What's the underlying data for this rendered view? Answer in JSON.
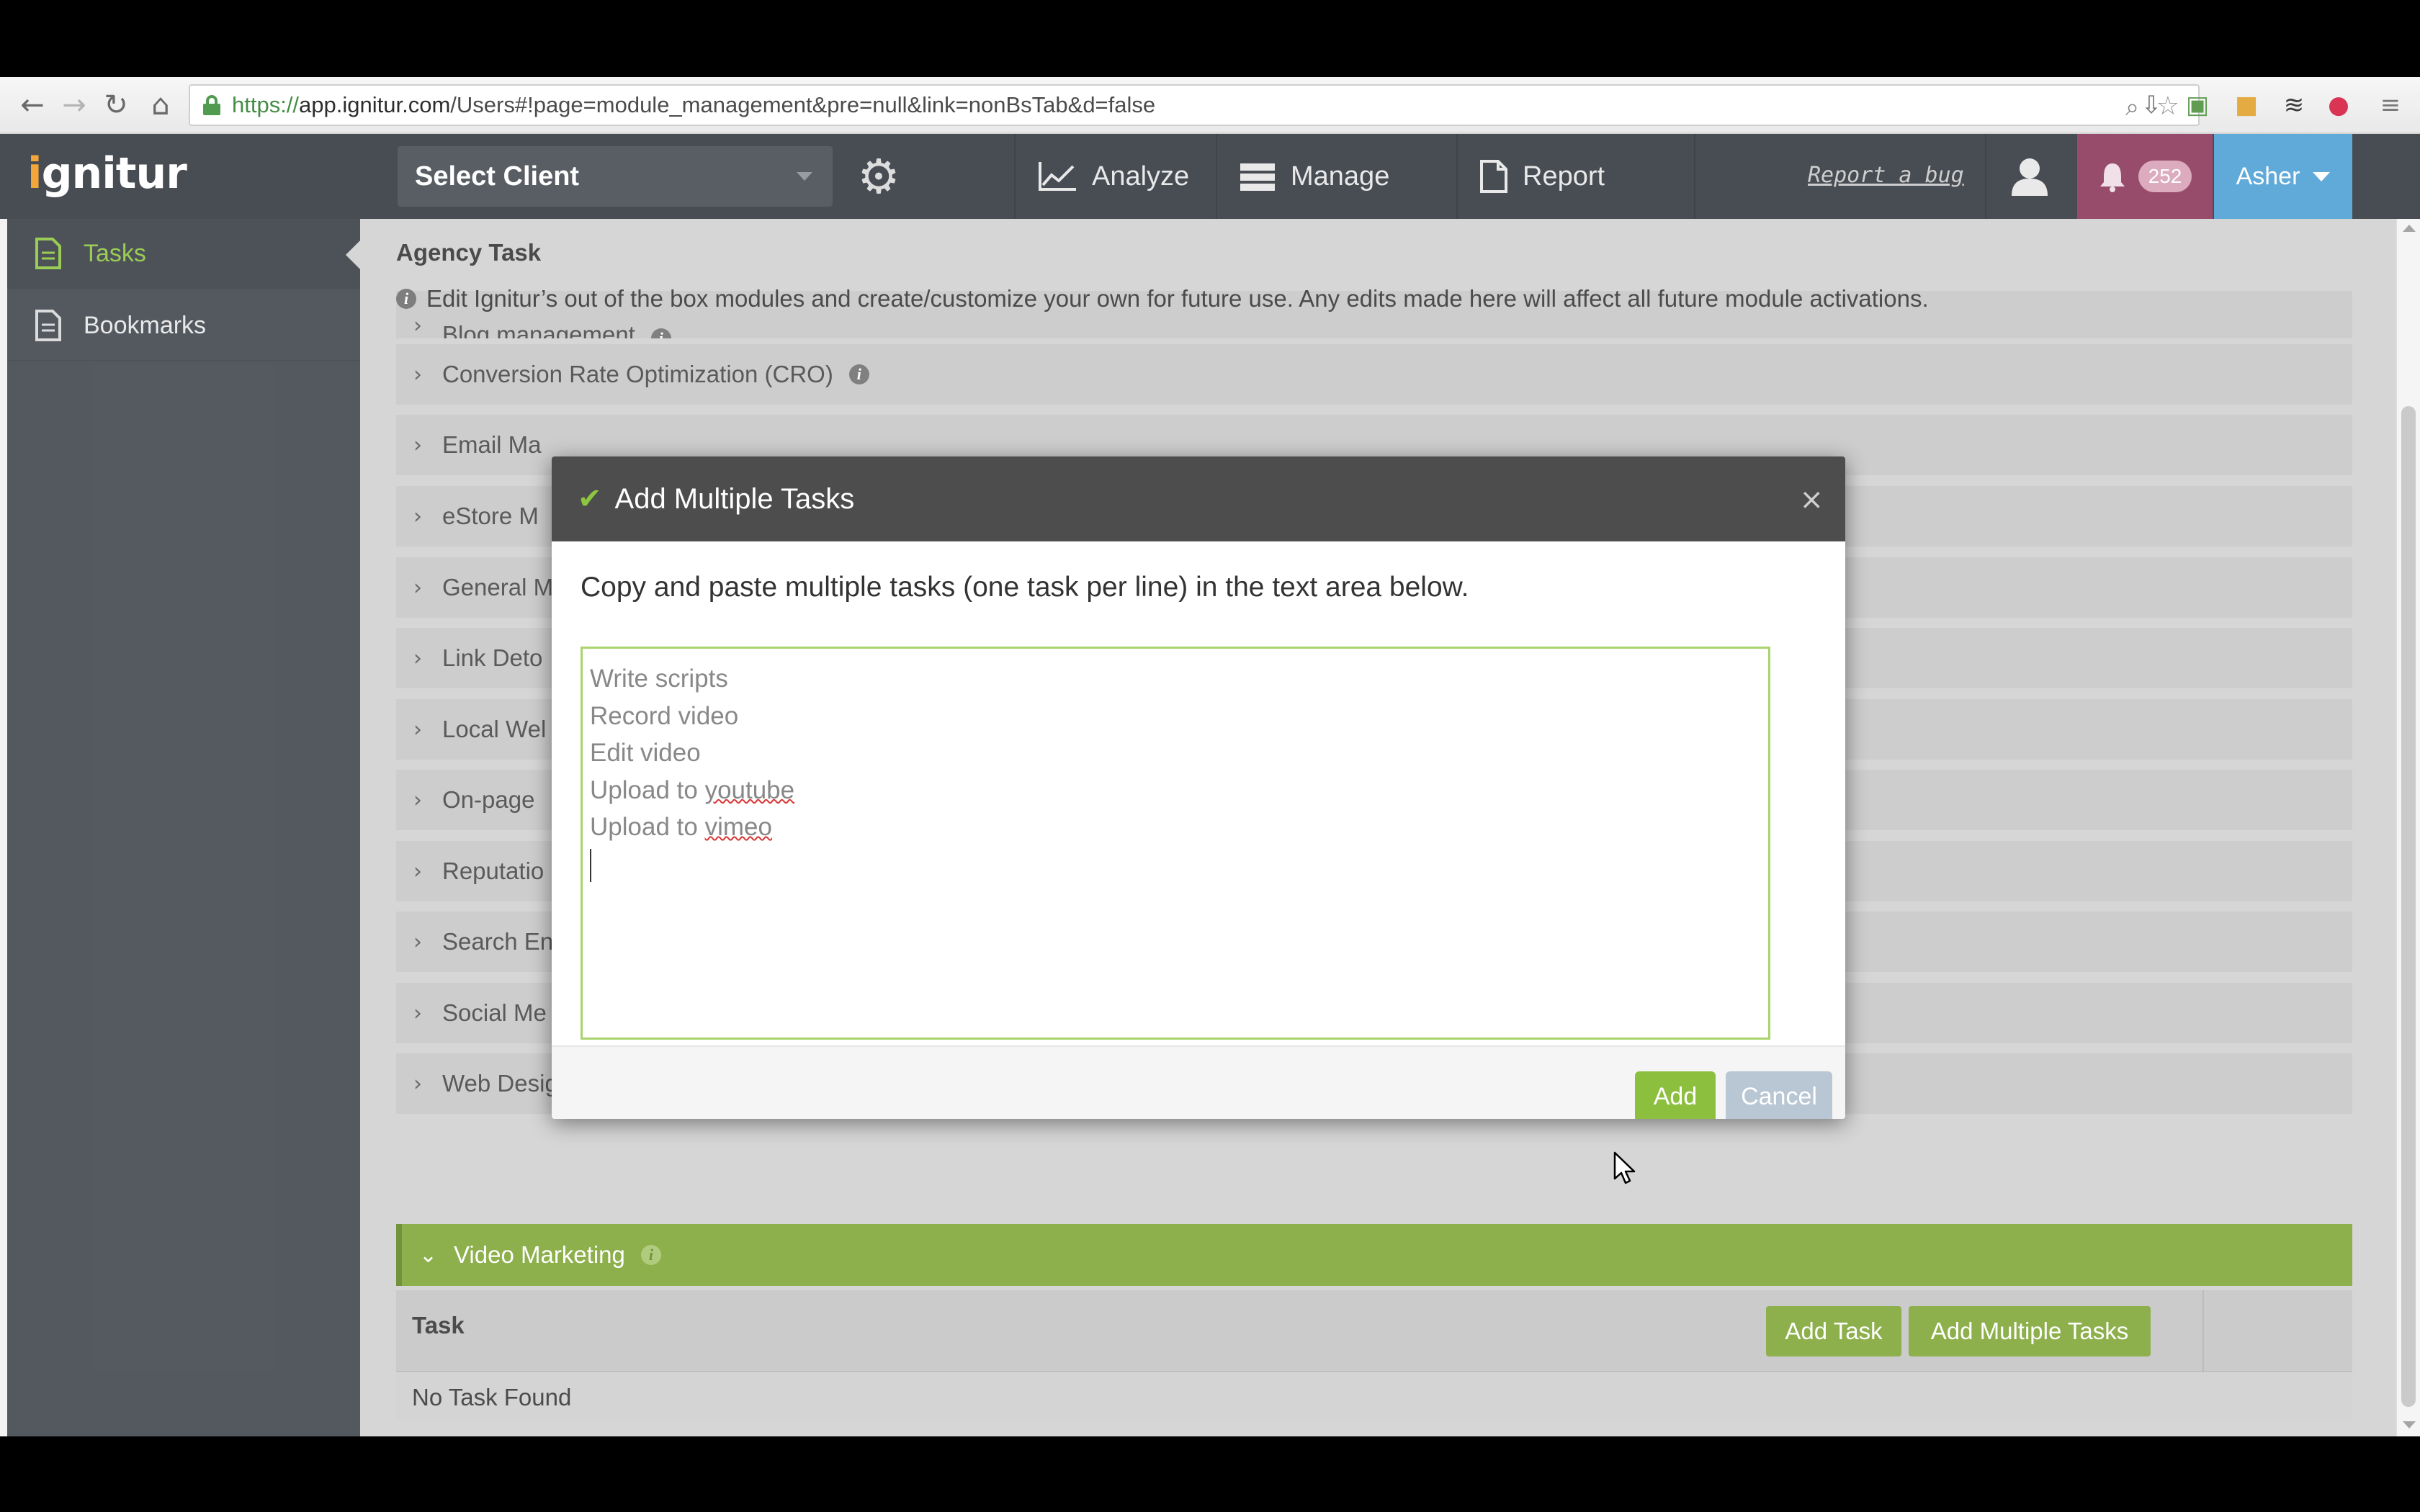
{
  "browser": {
    "url_scheme": "https://",
    "url_host": "app.ignitur.com",
    "url_path": "/Users#!page=module_management&pre=null&link=nonBsTab&d=false"
  },
  "header": {
    "logo": "ignitur",
    "client_select": "Select Client",
    "nav": [
      {
        "label": "Analyze",
        "icon": "line-chart-icon"
      },
      {
        "label": "Manage",
        "icon": "server-stack-icon"
      },
      {
        "label": "Report",
        "icon": "document-icon"
      }
    ],
    "report_bug": "Report a bug",
    "notifications_count": "252",
    "user_name": "Asher"
  },
  "sidebar": {
    "items": [
      {
        "label": "Tasks",
        "icon": "document-icon",
        "active": true
      },
      {
        "label": "Bookmarks",
        "icon": "document-icon",
        "active": false
      }
    ]
  },
  "main": {
    "title": "Agency Task",
    "info": "Edit Ignitur’s out of the box modules and create/customize your own for future use. Any edits made here will affect all future module activations.",
    "modules": [
      {
        "label": "Blog management"
      },
      {
        "label": "Conversion Rate Optimization (CRO)"
      },
      {
        "label": "Email Ma"
      },
      {
        "label": "eStore M"
      },
      {
        "label": "General M"
      },
      {
        "label": "Link Deto"
      },
      {
        "label": "Local Wel"
      },
      {
        "label": "On-page"
      },
      {
        "label": "Reputatio"
      },
      {
        "label": "Search En"
      },
      {
        "label": "Social Me"
      },
      {
        "label": "Web Design"
      }
    ],
    "expanded_module": "Video Marketing",
    "task_header": "Task",
    "add_task_label": "Add Task",
    "add_multiple_label": "Add Multiple Tasks",
    "empty_message": "No Task Found"
  },
  "modal": {
    "title": "Add Multiple Tasks",
    "close": "×",
    "instruction": "Copy and paste multiple tasks (one task per line) in the text area below.",
    "tasks": [
      "Write scripts",
      "Record video",
      "Edit video",
      "Upload to youtube",
      "Upload to vimeo"
    ],
    "add_label": "Add",
    "cancel_label": "Cancel"
  },
  "colors": {
    "accent_green": "#7ea634",
    "header_dark": "#2f343c",
    "user_blue": "#4b9fd5",
    "notif_magenta": "#8a3457"
  }
}
